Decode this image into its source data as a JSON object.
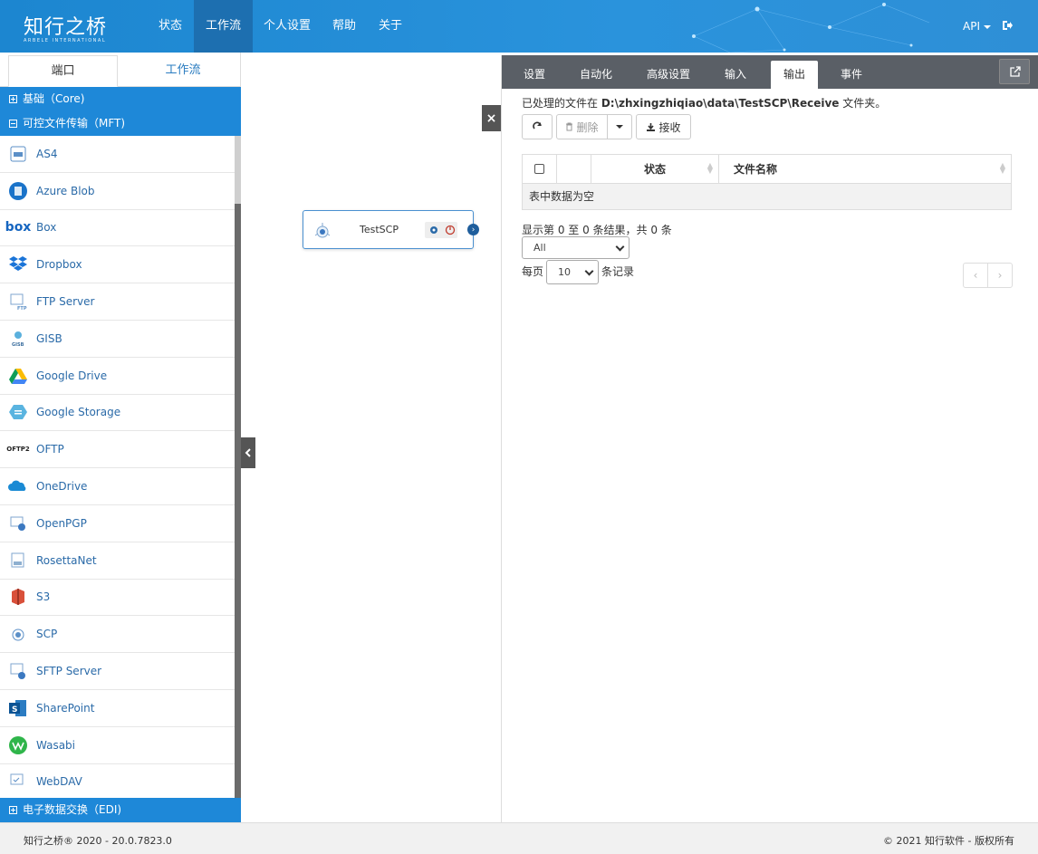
{
  "header": {
    "logo_name": "知行之桥",
    "logo_sub": "ARBELE INTERNATIONAL",
    "nav": [
      "状态",
      "工作流",
      "个人设置",
      "帮助",
      "关于"
    ],
    "active_nav": "工作流",
    "api_label": "API"
  },
  "sidebar": {
    "tabs": [
      "端口",
      "工作流"
    ],
    "groups": {
      "core": "基础（Core)",
      "mft": "可控文件传输（MFT)",
      "edi": "电子数据交换（EDI)"
    },
    "items": [
      {
        "label": "AS4",
        "icon": "as4-icon"
      },
      {
        "label": "Azure Blob",
        "icon": "azure-blob-icon"
      },
      {
        "label": "Box",
        "icon": "box-icon"
      },
      {
        "label": "Dropbox",
        "icon": "dropbox-icon"
      },
      {
        "label": "FTP Server",
        "icon": "ftp-icon"
      },
      {
        "label": "GISB",
        "icon": "gisb-icon"
      },
      {
        "label": "Google Drive",
        "icon": "google-drive-icon"
      },
      {
        "label": "Google Storage",
        "icon": "google-storage-icon"
      },
      {
        "label": "OFTP",
        "icon": "oftp-icon"
      },
      {
        "label": "OneDrive",
        "icon": "onedrive-icon"
      },
      {
        "label": "OpenPGP",
        "icon": "openpgp-icon"
      },
      {
        "label": "RosettaNet",
        "icon": "rosettanet-icon"
      },
      {
        "label": "S3",
        "icon": "s3-icon"
      },
      {
        "label": "SCP",
        "icon": "scp-icon"
      },
      {
        "label": "SFTP Server",
        "icon": "sftp-icon"
      },
      {
        "label": "SharePoint",
        "icon": "sharepoint-icon"
      },
      {
        "label": "Wasabi",
        "icon": "wasabi-icon"
      },
      {
        "label": "WebDAV",
        "icon": "webdav-icon"
      }
    ]
  },
  "canvas": {
    "node_label": "TestSCP"
  },
  "panel": {
    "tabs": [
      "设置",
      "自动化",
      "高级设置",
      "输入",
      "输出",
      "事件"
    ],
    "active_tab": "输出",
    "path_prefix": "已处理的文件在",
    "path": "D:\\zhxingzhiqiao\\data\\TestSCP\\Receive",
    "path_suffix": "文件夹。",
    "delete_label": "删除",
    "receive_label": "接收",
    "columns": [
      "状态",
      "文件名称"
    ],
    "empty_text": "表中数据为空",
    "info_text": "显示第 0 至 0 条结果，共 0 条",
    "filter_value": "All",
    "per_page_prefix": "每页",
    "per_page_value": "10",
    "per_page_suffix": "条记录",
    "prev": "‹",
    "next": "›"
  },
  "footer": {
    "left": "知行之桥® 2020 - 20.0.7823.0",
    "right": "© 2021 知行软件 - 版权所有"
  },
  "colors": {
    "brand": "#1e88d8",
    "nav_active": "#1d6fb0",
    "tab_bar": "#5a5f66"
  }
}
